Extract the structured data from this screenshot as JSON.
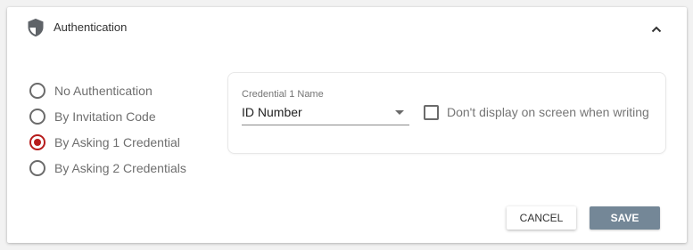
{
  "header": {
    "title": "Authentication",
    "icon": "shield-icon",
    "collapse_icon": "chevron-up-icon"
  },
  "auth_options": [
    {
      "label": "No Authentication",
      "selected": false
    },
    {
      "label": "By Invitation Code",
      "selected": false
    },
    {
      "label": "By Asking 1 Credential",
      "selected": true
    },
    {
      "label": "By Asking 2 Credentials",
      "selected": false
    }
  ],
  "credential": {
    "field_label": "Credential 1 Name",
    "selected_value": "ID Number",
    "hide_checkbox_label": "Don't display on screen when writing",
    "hide_checked": false
  },
  "actions": {
    "cancel_label": "CANCEL",
    "save_label": "SAVE"
  },
  "colors": {
    "accent_radio": "#b71c1c",
    "save_button": "#748797"
  }
}
